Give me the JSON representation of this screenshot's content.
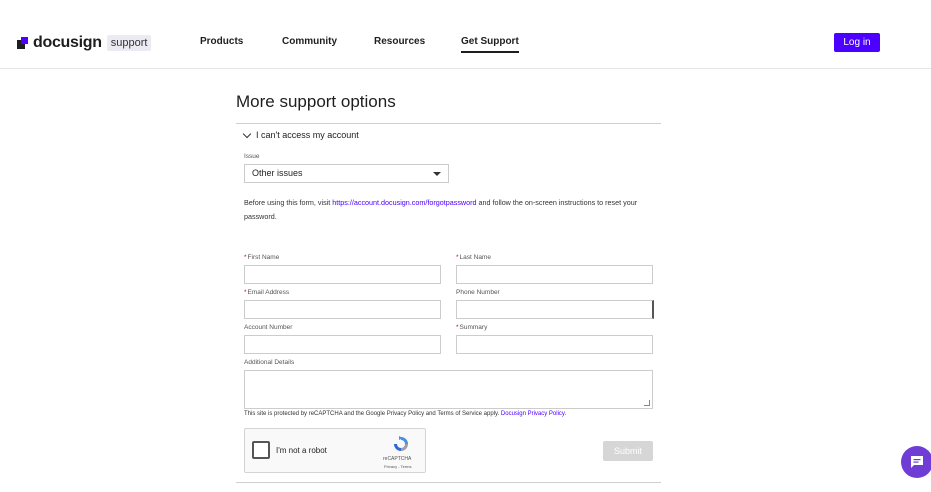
{
  "header": {
    "logo_text": "docusign",
    "logo_badge": "support",
    "nav": [
      "Products",
      "Community",
      "Resources",
      "Get Support"
    ],
    "login_label": "Log in"
  },
  "main": {
    "title": "More support options",
    "accordion_label": "I can't access my account",
    "issue_label": "Issue",
    "issue_value": "Other issues",
    "info_before": "Before using this form, visit ",
    "info_link": "https://account.docusign.com/forgotpassword",
    "info_after": " and follow the on-screen instructions to reset your password.",
    "fields": {
      "first_name": "First Name",
      "last_name": "Last Name",
      "email": "Email Address",
      "phone": "Phone Number",
      "account_number": "Account Number",
      "summary": "Summary",
      "additional_details": "Additional Details"
    },
    "recaptcha_note": "This site is protected by reCAPTCHA and the Google Privacy Policy and Terms of Service apply.",
    "privacy_link": "Docusign Privacy Policy.",
    "captcha_text": "I'm not a robot",
    "captcha_brand": "reCAPTCHA",
    "captcha_links": "Privacy - Terms",
    "submit_label": "Submit"
  },
  "colors": {
    "brand": "#4c00ff",
    "chat": "#6f3dd6"
  }
}
